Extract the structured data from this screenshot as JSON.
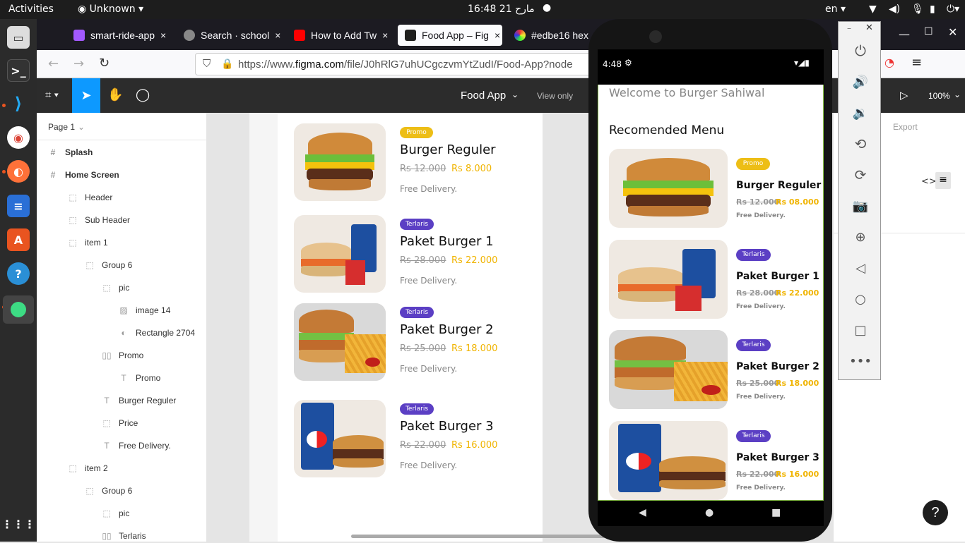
{
  "system": {
    "activities": "Activities",
    "app_name": "Unknown",
    "clock": "16:48 مارح 21",
    "lang": "en"
  },
  "tabs": [
    {
      "title": "smart-ride-app",
      "close": "×"
    },
    {
      "title": "Search · school",
      "close": "×"
    },
    {
      "title": "How to Add Tw",
      "close": "×"
    },
    {
      "title": "Food App – Fig",
      "close": "×"
    },
    {
      "title": "#edbe16 hex",
      "close": ""
    }
  ],
  "url": {
    "prefix": "https://www.",
    "domain": "figma.com",
    "rest": "/file/J0hRlG7uhUCgczvmYtZudI/Food-App?node"
  },
  "figma": {
    "file_name": "Food App",
    "view_only": "View only",
    "zoom": "100%",
    "export": "Export",
    "page": "Page 1"
  },
  "layers": [
    {
      "icon": "#",
      "label": "Splash"
    },
    {
      "icon": "#",
      "label": "Home Screen"
    },
    {
      "icon": "⬚",
      "label": "Header"
    },
    {
      "icon": "⬚",
      "label": "Sub Header"
    },
    {
      "icon": "⬚",
      "label": "item 1"
    },
    {
      "icon": "⬚",
      "label": "Group 6"
    },
    {
      "icon": "⬚",
      "label": "pic"
    },
    {
      "icon": "▨",
      "label": "image 14"
    },
    {
      "icon": "◐",
      "label": "Rectangle 2704"
    },
    {
      "icon": "▯▯",
      "label": "Promo"
    },
    {
      "icon": "T",
      "label": "Promo"
    },
    {
      "icon": "T",
      "label": "Burger Reguler"
    },
    {
      "icon": "⬚",
      "label": "Price"
    },
    {
      "icon": "T",
      "label": "Free Delivery."
    },
    {
      "icon": "⬚",
      "label": "item 2"
    },
    {
      "icon": "⬚",
      "label": "Group 6"
    },
    {
      "icon": "⬚",
      "label": "pic"
    },
    {
      "icon": "▯▯",
      "label": "Terlaris"
    }
  ],
  "design_items": [
    {
      "badge": "Promo",
      "name": "Burger Reguler",
      "old": "Rs 12.000",
      "new": "Rs 8.000",
      "delivery": "Free Delivery."
    },
    {
      "badge": "Terlaris",
      "name": "Paket Burger 1",
      "old": "Rs 28.000",
      "new": "Rs 22.000",
      "delivery": "Free Delivery."
    },
    {
      "badge": "Terlaris",
      "name": "Paket Burger 2",
      "old": "Rs 25.000",
      "new": "Rs 18.000",
      "delivery": "Free Delivery."
    },
    {
      "badge": "Terlaris",
      "name": "Paket Burger 3",
      "old": "Rs 22.000",
      "new": "Rs 16.000",
      "delivery": "Free Delivery."
    }
  ],
  "phone": {
    "time": "4:48",
    "welcome": "Welcome to Burger Sahiwal",
    "section": "Recomended Menu",
    "items": [
      {
        "badge": "Promo",
        "name": "Burger Reguler",
        "old": "Rs 12.000",
        "new": "Rs 08.000",
        "delivery": "Free Delivery."
      },
      {
        "badge": "Terlaris",
        "name": "Paket Burger 1",
        "old": "Rs 28.000",
        "new": "Rs 22.000",
        "delivery": "Free Delivery."
      },
      {
        "badge": "Terlaris",
        "name": "Paket Burger 2",
        "old": "Rs 25.000",
        "new": "Rs 18.000",
        "delivery": "Free Delivery."
      },
      {
        "badge": "Terlaris",
        "name": "Paket Burger 3",
        "old": "Rs 22.000",
        "new": "Rs 16.000",
        "delivery": "Free Delivery."
      }
    ]
  },
  "help": "?",
  "colors": {
    "promo": "#edbe16",
    "terlaris": "#5b3fc4",
    "price": "#f0b400",
    "figma_select": "#0d99ff"
  }
}
